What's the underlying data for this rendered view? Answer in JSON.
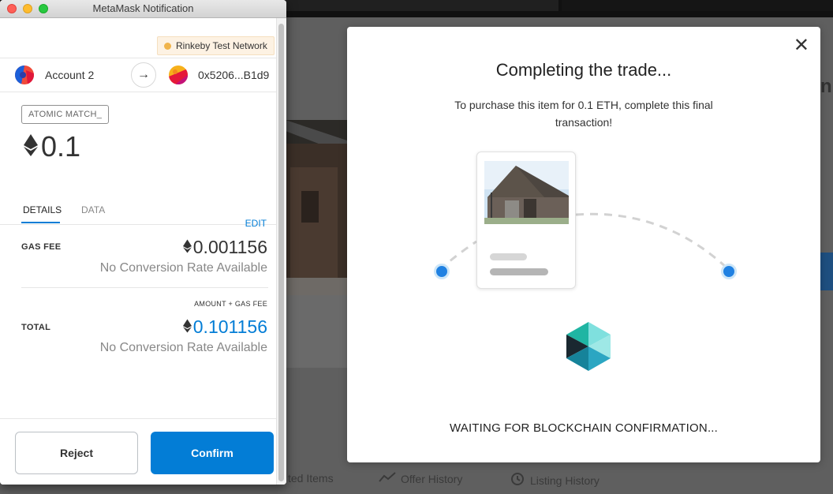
{
  "metamask": {
    "window_title": "MetaMask Notification",
    "network": "Rinkeby Test Network",
    "from_account": "Account 2",
    "to_address": "0x5206...B1d9",
    "method": "ATOMIC MATCH_",
    "amount": "0.1",
    "tabs": [
      "DETAILS",
      "DATA"
    ],
    "active_tab": "DETAILS",
    "edit_label": "EDIT",
    "gas_fee": {
      "label": "GAS FEE",
      "value": "0.001156",
      "conversion": "No Conversion Rate Available"
    },
    "total": {
      "caption": "AMOUNT + GAS FEE",
      "label": "TOTAL",
      "value": "0.101156",
      "conversion": "No Conversion Rate Available"
    },
    "buttons": {
      "reject": "Reject",
      "confirm": "Confirm"
    },
    "colors": {
      "accent": "#037dd6",
      "network_dot": "#f0b44c"
    }
  },
  "modal": {
    "title": "Completing the trade...",
    "subtitle": "To purchase this item for 0.1 ETH, complete this final transaction!",
    "status": "WAITING FOR BLOCKCHAIN CONFIRMATION...",
    "close_icon": "close-icon",
    "colors": {
      "node": "#2081e2"
    }
  },
  "background": {
    "tabs": [
      "ted Items",
      "Offer History",
      "Listing History"
    ],
    "partial_heading": "n"
  }
}
